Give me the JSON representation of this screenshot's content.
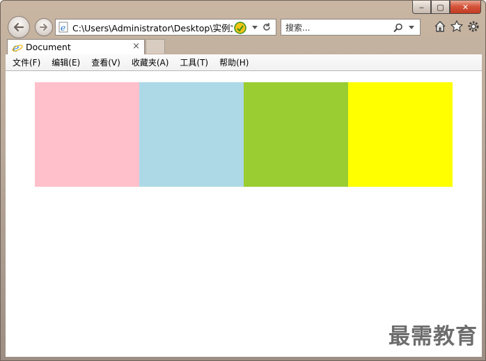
{
  "window": {
    "caption": {
      "minimize": "‒",
      "maximize": "▢",
      "close": "✕"
    }
  },
  "nav": {
    "back_icon": "back-arrow-icon",
    "forward_icon": "forward-arrow-icon",
    "address": "C:\\Users\\Administrator\\Desktop\\实例文",
    "search_placeholder": "搜索..."
  },
  "tab": {
    "title": "Document",
    "close": "×"
  },
  "menu": [
    {
      "label": "文件(F)"
    },
    {
      "label": "编辑(E)"
    },
    {
      "label": "查看(V)"
    },
    {
      "label": "收藏夹(A)"
    },
    {
      "label": "工具(T)"
    },
    {
      "label": "帮助(H)"
    }
  ],
  "content": {
    "boxes": [
      {
        "color": "#ffc0cb"
      },
      {
        "color": "#add8e6"
      },
      {
        "color": "#9acd32"
      },
      {
        "color": "#ffff00"
      }
    ],
    "watermark": "最需教育"
  }
}
